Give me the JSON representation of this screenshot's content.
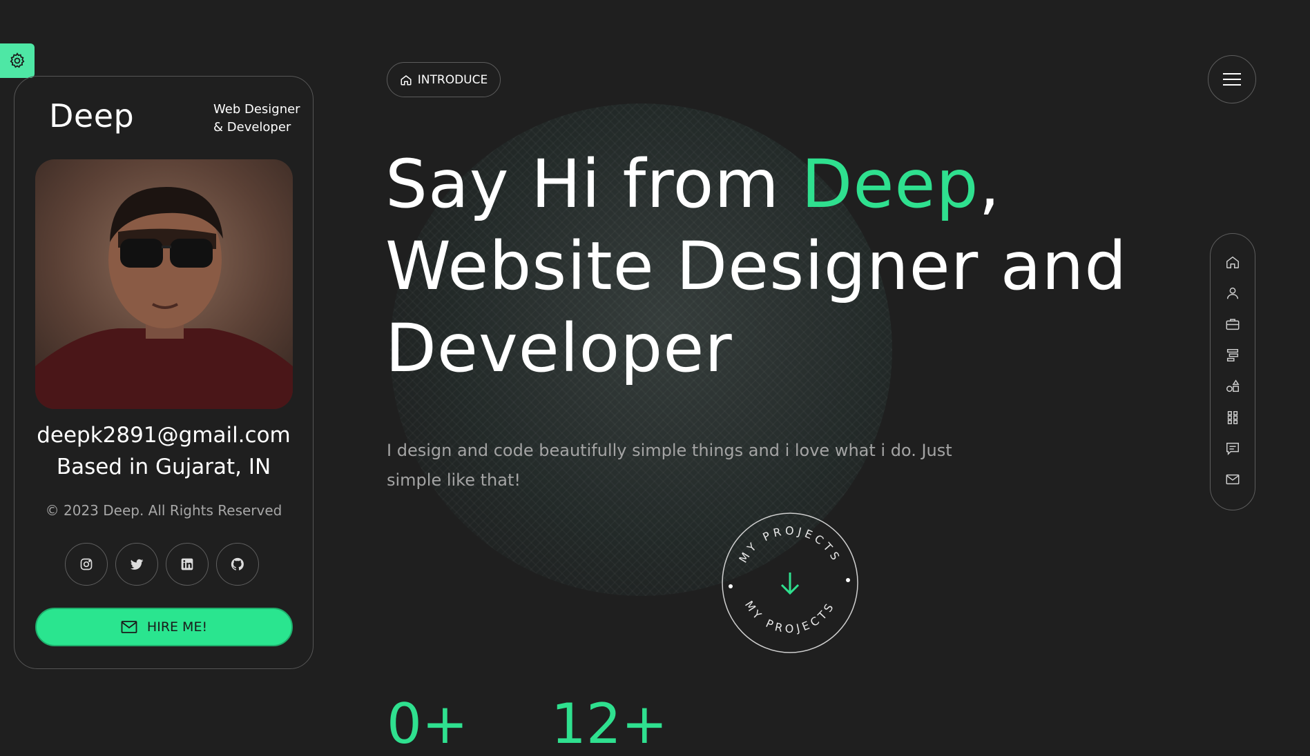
{
  "profile": {
    "name": "Deep",
    "role_line1": "Web Designer",
    "role_line2": "& Developer",
    "email": "deepk2891@gmail.com",
    "location": "Based in Gujarat, IN",
    "copyright": "© 2023 Deep. All Rights Reserved",
    "hire_label": "HIRE ME!",
    "socials": [
      "instagram-icon",
      "twitter-icon",
      "linkedin-icon",
      "github-icon"
    ]
  },
  "intro": {
    "pill_label": "INTRODUCE",
    "headline_part1": "Say Hi from ",
    "headline_accent": "Deep",
    "headline_part2": ",",
    "headline_line2": "Website Designer and",
    "headline_line3": "Developer",
    "lead": "I design and code beautifully simple things and i love what i do. Just simple like that!",
    "projects_circle_text": "MY PROJECTS"
  },
  "stats": [
    {
      "value": "0+"
    },
    {
      "value": "12+"
    }
  ],
  "sidenav": [
    "home-icon",
    "user-icon",
    "briefcase-icon",
    "align-icon",
    "shapes-icon",
    "grid-icon",
    "chat-icon",
    "mail-icon"
  ],
  "colors": {
    "accent": "#2fe08f",
    "background": "#1f1f1f",
    "settings": "#4ee7a5"
  }
}
